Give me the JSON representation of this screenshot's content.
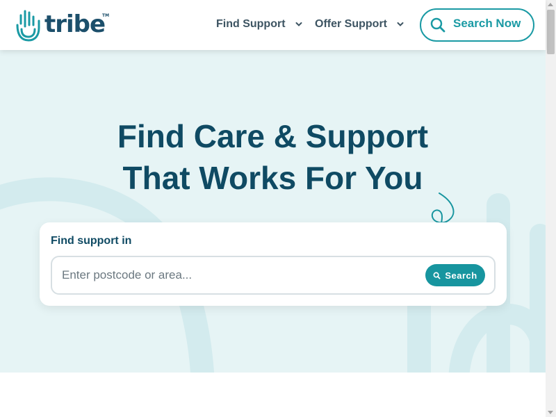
{
  "header": {
    "logo_text": "tribe",
    "logo_tm": "TM",
    "nav": [
      {
        "label": "Find Support"
      },
      {
        "label": "Offer Support"
      }
    ],
    "cta_label": "Search Now"
  },
  "hero": {
    "title_line1": "Find Care & Support",
    "title_line2": "That Works For You",
    "search": {
      "label": "Find support in",
      "placeholder": "Enter postcode or area...",
      "button_label": "Search"
    }
  },
  "colors": {
    "brand_teal": "#1a9aa4",
    "brand_navy": "#0f4a63",
    "hero_bg": "#e6f4f5"
  }
}
